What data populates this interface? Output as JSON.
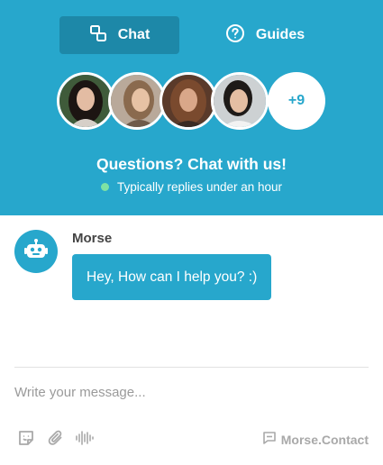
{
  "tabs": [
    {
      "label": "Chat",
      "icon": "chat-icon"
    },
    {
      "label": "Guides",
      "icon": "question-icon"
    }
  ],
  "team": {
    "more_count": "+9"
  },
  "header": {
    "headline": "Questions? Chat with us!",
    "status": "Typically replies under an hour"
  },
  "conversation": {
    "sender": "Morse",
    "message": "Hey, How can I help you? :)"
  },
  "composer": {
    "placeholder": "Write your message..."
  },
  "footer": {
    "brand": "Morse.Contact"
  },
  "colors": {
    "accent": "#27a7cc",
    "accent_dark": "#1d88a8",
    "online": "#7ee2a4"
  }
}
